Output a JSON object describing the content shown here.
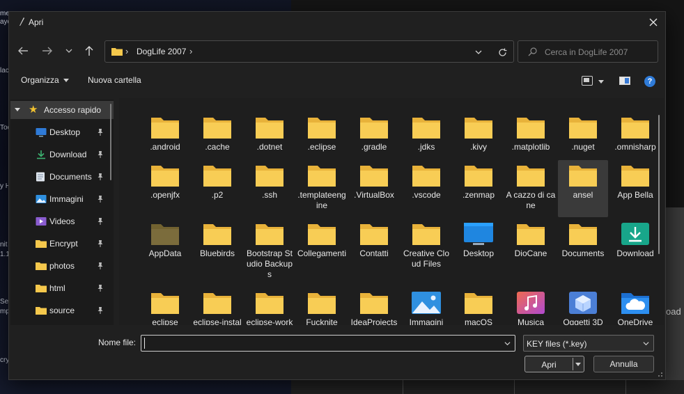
{
  "dialog": {
    "title": "Apri",
    "address": {
      "folder": "DogLife 2007"
    },
    "search": {
      "placeholder": "Cerca in DogLife 2007"
    },
    "toolbar": {
      "organize_label": "Organizza",
      "new_folder_label": "Nuova cartella",
      "help_label": "?"
    },
    "sidebar": {
      "quick_access": {
        "label": "Accesso rapido",
        "icon": "star-icon"
      },
      "items": [
        {
          "label": "Desktop",
          "icon": "desktop-icon",
          "pinned": true
        },
        {
          "label": "Download",
          "icon": "download-icon",
          "pinned": true
        },
        {
          "label": "Documents",
          "icon": "documents-icon",
          "pinned": true
        },
        {
          "label": "Immagini",
          "icon": "pictures-icon",
          "pinned": true
        },
        {
          "label": "Videos",
          "icon": "videos-icon",
          "pinned": true
        },
        {
          "label": "Encrypt",
          "icon": "folder-icon",
          "pinned": true
        },
        {
          "label": "photos",
          "icon": "folder-icon",
          "pinned": true
        },
        {
          "label": "html",
          "icon": "folder-icon",
          "pinned": true
        },
        {
          "label": "source",
          "icon": "folder-icon",
          "pinned": true
        }
      ]
    },
    "items": [
      {
        "label": ".android",
        "icon": "folder"
      },
      {
        "label": ".cache",
        "icon": "folder"
      },
      {
        "label": ".dotnet",
        "icon": "folder"
      },
      {
        "label": ".eclipse",
        "icon": "folder"
      },
      {
        "label": ".gradle",
        "icon": "folder"
      },
      {
        "label": ".jdks",
        "icon": "folder"
      },
      {
        "label": ".kivy",
        "icon": "folder"
      },
      {
        "label": ".matplotlib",
        "icon": "folder"
      },
      {
        "label": ".nuget",
        "icon": "folder"
      },
      {
        "label": ".omnisharp",
        "icon": "folder"
      },
      {
        "label": ".openjfx",
        "icon": "folder"
      },
      {
        "label": ".p2",
        "icon": "folder"
      },
      {
        "label": ".ssh",
        "icon": "folder"
      },
      {
        "label": ".templateengine",
        "icon": "folder"
      },
      {
        "label": ".VirtualBox",
        "icon": "folder"
      },
      {
        "label": ".vscode",
        "icon": "folder"
      },
      {
        "label": ".zenmap",
        "icon": "folder"
      },
      {
        "label": "A cazzo di cane",
        "icon": "folder"
      },
      {
        "label": "ansel",
        "icon": "folder",
        "selected": true
      },
      {
        "label": "App Bella",
        "icon": "folder"
      },
      {
        "label": "AppData",
        "icon": "folder-hidden"
      },
      {
        "label": "Bluebirds",
        "icon": "folder"
      },
      {
        "label": "Bootstrap Studio Backups",
        "icon": "folder"
      },
      {
        "label": "Collegamenti",
        "icon": "folder"
      },
      {
        "label": "Contatti",
        "icon": "folder"
      },
      {
        "label": "Creative Cloud Files",
        "icon": "folder"
      },
      {
        "label": "Desktop",
        "icon": "desktop"
      },
      {
        "label": "DioCane",
        "icon": "folder"
      },
      {
        "label": "Documents",
        "icon": "folder"
      },
      {
        "label": "Download",
        "icon": "download"
      },
      {
        "label": "eclipse",
        "icon": "folder"
      },
      {
        "label": "eclipse-installer",
        "icon": "folder"
      },
      {
        "label": "eclipse-workspace",
        "icon": "folder"
      },
      {
        "label": "Fucknite",
        "icon": "folder"
      },
      {
        "label": "IdeaProjects",
        "icon": "folder"
      },
      {
        "label": "Immagini",
        "icon": "pictures"
      },
      {
        "label": "macOS",
        "icon": "folder"
      },
      {
        "label": "Musica",
        "icon": "music"
      },
      {
        "label": "Oggetti 3D",
        "icon": "objects3d"
      },
      {
        "label": "OneDrive",
        "icon": "onedrive"
      }
    ],
    "filename": {
      "label": "Nome file:",
      "value": ""
    },
    "filetype": {
      "value": "KEY files (*.key)"
    },
    "buttons": {
      "open": "Apri",
      "cancel": "Annulla"
    }
  },
  "background": {
    "right_text": "oad",
    "fragments": [
      "me",
      "ayo",
      "lac",
      "Too",
      "y H",
      "nit",
      "1.1",
      "Se",
      "mp",
      "cry"
    ]
  },
  "colors": {
    "folder": "#f5c84c",
    "folder_tab": "#e8b23a",
    "accent": "#2f7bd8",
    "selection": "#3a3a3a"
  }
}
